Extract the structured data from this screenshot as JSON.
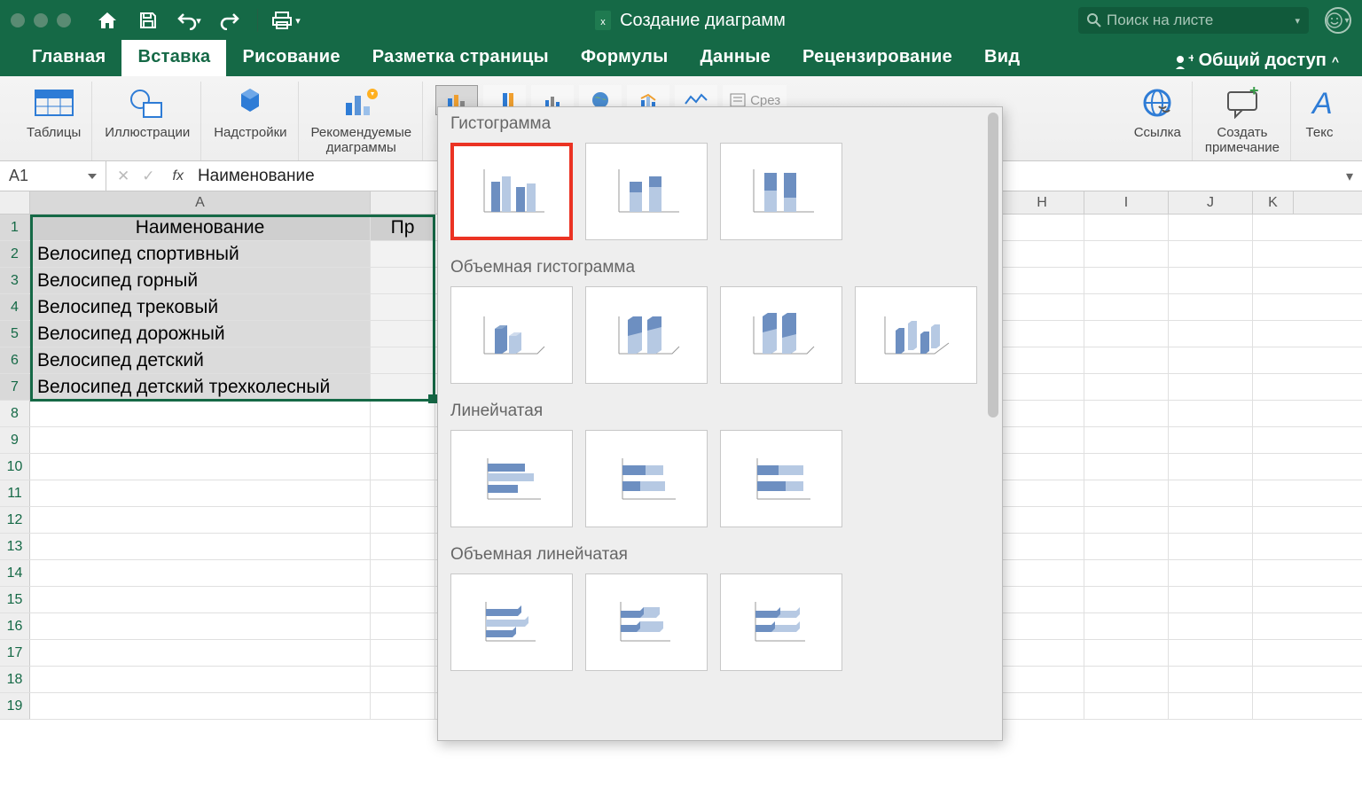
{
  "titlebar": {
    "doc_title": "Создание диаграмм",
    "search_placeholder": "Поиск на листе"
  },
  "tabs": {
    "items": [
      "Главная",
      "Вставка",
      "Рисование",
      "Разметка страницы",
      "Формулы",
      "Данные",
      "Рецензирование",
      "Вид"
    ],
    "share": "Общий доступ"
  },
  "ribbon": {
    "groups": {
      "tables": "Таблицы",
      "illustrations": "Иллюстрации",
      "addins": "Надстройки",
      "recommended": "Рекомендуемые\nдиаграммы",
      "slicer": "Срез",
      "link": "Ссылка",
      "comment": "Создать\nпримечание",
      "text": "Текс"
    }
  },
  "formula": {
    "cell_ref": "A1",
    "value": "Наименование"
  },
  "columns": [
    "A",
    "H",
    "I",
    "J",
    "K"
  ],
  "sheet": {
    "header_a": "Наименование",
    "header_b": "Пр",
    "rows": [
      "Велосипед спортивный",
      "Велосипед горный",
      "Велосипед трековый",
      "Велосипед дорожный",
      "Велосипед детский",
      "Велосипед детский трехколесный"
    ],
    "row_numbers": [
      1,
      2,
      3,
      4,
      5,
      6,
      7,
      8,
      9,
      10,
      11,
      12,
      13,
      14,
      15,
      16,
      17,
      18,
      19
    ]
  },
  "gallery": {
    "cat1": "Гистограмма",
    "cat2": "Объемная гистограмма",
    "cat3": "Линейчатая",
    "cat4": "Объемная линейчатая"
  }
}
